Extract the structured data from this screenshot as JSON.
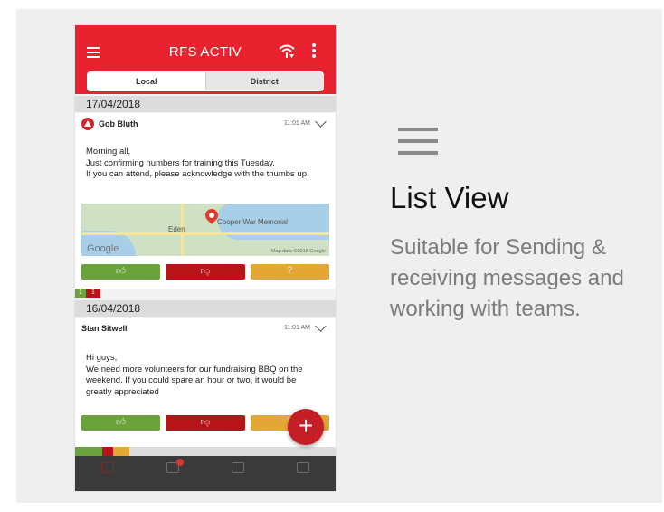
{
  "app": {
    "title": "RFS ACTIV",
    "tabs": [
      "Local",
      "District"
    ],
    "active_tab": "Local"
  },
  "messages": [
    {
      "date": "17/04/2018",
      "sender": "Gob Bluth",
      "time": "11:01 AM",
      "icon": "warning-icon",
      "body": "Morning all,\nJust confirming numbers for training this Tuesday.\nIf you can attend, please acknowledge with the thumbs up.",
      "map": {
        "labels": [
          "Eden",
          "Cooper War Memorial"
        ],
        "logo": "Google",
        "attribution": "Map data ©2018 Google"
      },
      "tally": [
        "1",
        "1"
      ]
    },
    {
      "date": "16/04/2018",
      "sender": "Stan Sitwell",
      "time": "11:01 AM",
      "body": "Hi guys,\nWe need more volunteers for our fundraising BBQ on the weekend. If you could spare an hour or two, it would be greatly appreciated"
    }
  ],
  "fab_label": "+",
  "colors": {
    "appbar": "#e8232f",
    "thumbs_up": "#6aa33c",
    "thumbs_down": "#b7141a",
    "other": "#e3a833",
    "fab": "#c41f26"
  },
  "feature": {
    "icon": "list-icon",
    "title": "List View",
    "description": "Suitable for Sending & receiving messages and working with teams."
  }
}
